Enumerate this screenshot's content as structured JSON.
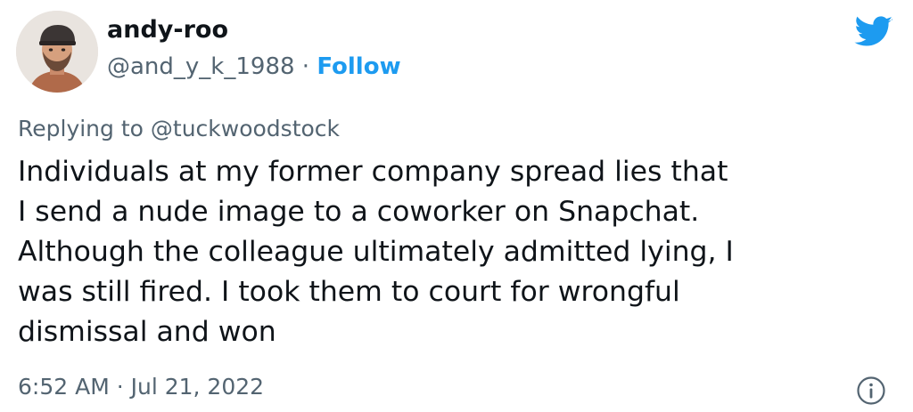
{
  "tweet": {
    "author": {
      "display_name": "andy-roo",
      "handle": "@and_y_k_1988",
      "separator": " · ",
      "follow_label": "Follow"
    },
    "replying": {
      "prefix": "Replying to ",
      "handle": "@tuckwoodstock"
    },
    "body_lines": [
      "Individuals at my former company spread lies that",
      "I send a nude image to a coworker on Snapchat.",
      "Although the colleague ultimately admitted lying, I",
      "was still fired. I took them to court for wrongful",
      "dismissal and won"
    ],
    "timestamp": "6:52 AM · Jul 21, 2022"
  },
  "icons": {
    "brand": "twitter-bird-icon",
    "info": "info-icon"
  },
  "colors": {
    "accent": "#1d9bf0",
    "text_primary": "#0f1419",
    "text_secondary": "#536471"
  }
}
